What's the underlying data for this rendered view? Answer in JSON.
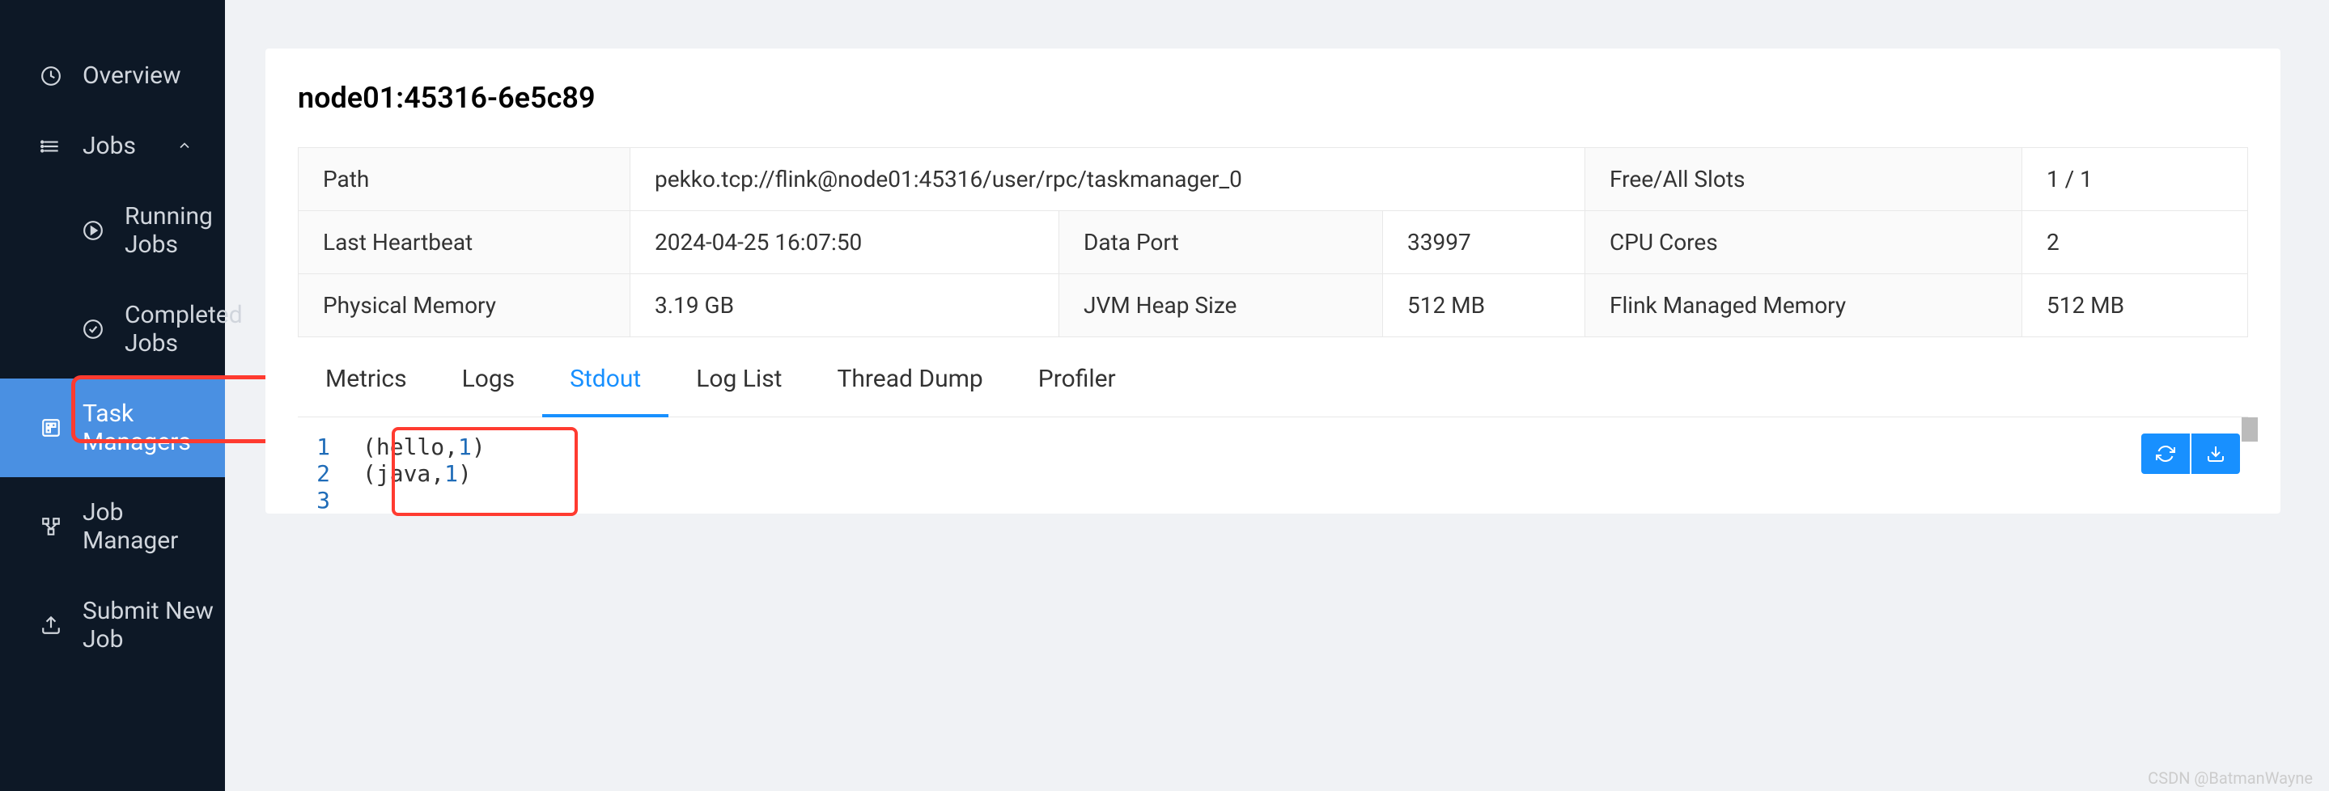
{
  "sidebar": {
    "items": [
      {
        "label": "Overview",
        "icon": "dashboard"
      },
      {
        "label": "Jobs",
        "icon": "bars",
        "expanded": true
      },
      {
        "label": "Running Jobs",
        "icon": "play-circle",
        "sub": true
      },
      {
        "label": "Completed Jobs",
        "icon": "check-circle",
        "sub": true
      },
      {
        "label": "Task Managers",
        "icon": "build",
        "active": true
      },
      {
        "label": "Job Manager",
        "icon": "cluster"
      },
      {
        "label": "Submit New Job",
        "icon": "upload"
      }
    ]
  },
  "header": {
    "title": "node01:45316-6e5c89"
  },
  "info": {
    "path_label": "Path",
    "path_value": "pekko.tcp://flink@node01:45316/user/rpc/taskmanager_0",
    "slots_label": "Free/All Slots",
    "slots_value": "1 / 1",
    "heartbeat_label": "Last Heartbeat",
    "heartbeat_value": "2024-04-25 16:07:50",
    "dataport_label": "Data Port",
    "dataport_value": "33997",
    "cores_label": "CPU Cores",
    "cores_value": "2",
    "physmem_label": "Physical Memory",
    "physmem_value": "3.19 GB",
    "heap_label": "JVM Heap Size",
    "heap_value": "512 MB",
    "managed_label": "Flink Managed Memory",
    "managed_value": "512 MB"
  },
  "tabs": {
    "items": [
      "Metrics",
      "Logs",
      "Stdout",
      "Log List",
      "Thread Dump",
      "Profiler"
    ],
    "active": "Stdout"
  },
  "stdout": {
    "lines": [
      {
        "num": "1",
        "parts": [
          "(hello,",
          "1",
          ")"
        ]
      },
      {
        "num": "2",
        "parts": [
          "(java,",
          "1",
          ")"
        ]
      },
      {
        "num": "3",
        "parts": []
      }
    ]
  },
  "watermark": "CSDN @BatmanWayne"
}
